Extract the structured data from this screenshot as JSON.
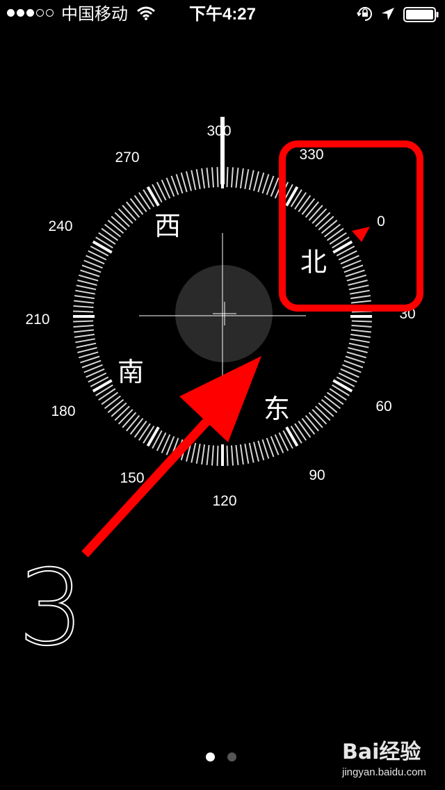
{
  "status_bar": {
    "carrier": "中国移动",
    "time": "下午4:27",
    "signal_bars_filled": 3,
    "signal_bars_total": 5,
    "icons": [
      "signal-dots",
      "wifi-icon",
      "rotation-lock-icon",
      "location-arrow-icon",
      "battery-icon"
    ]
  },
  "compass": {
    "numbers": [
      "300",
      "330",
      "0",
      "30",
      "60",
      "90",
      "120",
      "150",
      "180",
      "210",
      "240",
      "270"
    ],
    "cardinals": {
      "north": "北",
      "east": "东",
      "south": "南",
      "west": "西"
    },
    "heading_marker_color": "#ff0000"
  },
  "annotation": {
    "step_number": "3",
    "highlight_color": "#ff0000",
    "arrow_color": "#ff0000"
  },
  "pager": {
    "pages": 2,
    "active_index": 0
  },
  "watermark": {
    "logo": "Bai经验",
    "url": "jingyan.baidu.com"
  }
}
